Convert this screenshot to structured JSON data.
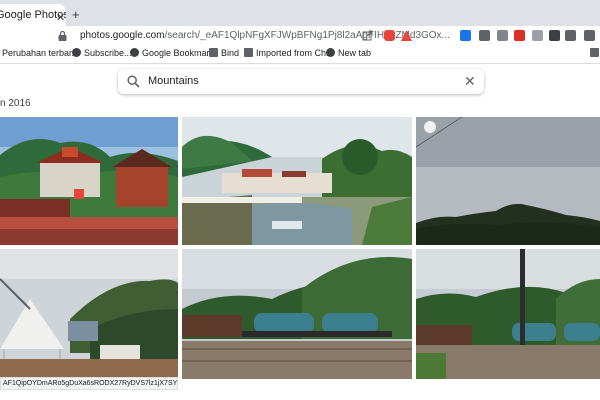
{
  "browser": {
    "tab_title": "Google Photos",
    "url_host": "photos.google.com",
    "url_path": "/search/_eAF1QlpNFgXFJWpBFNg1Pj8l2aAgFIH~uZMd3GOx...",
    "status_url": "AF1QipOYDmARo5gDuXa6sRODX27RyDVS7lz1jX7SY..."
  },
  "bookmarks": [
    {
      "label": "Perubahan terbar...",
      "icon": "globe-icon"
    },
    {
      "label": "Subscribe...",
      "icon": "globe-icon"
    },
    {
      "label": "Google Bookmark",
      "icon": "globe-icon"
    },
    {
      "label": "Bind",
      "icon": "folder-icon"
    },
    {
      "label": "Imported from Ch...",
      "icon": "folder-icon"
    },
    {
      "label": "New tab",
      "icon": "globe-icon"
    }
  ],
  "search": {
    "query": "Mountains"
  },
  "section": {
    "date_label": "n 2016"
  },
  "photos": [
    {
      "name": "photo-temple-mountains"
    },
    {
      "name": "photo-river-village"
    },
    {
      "name": "photo-mountain-cloudy"
    },
    {
      "name": "photo-tent-mountain"
    },
    {
      "name": "photo-train-tankers"
    },
    {
      "name": "photo-train-pole"
    }
  ],
  "colors": {
    "accent": "#1a73e8",
    "tabstrip": "#dee1e6"
  }
}
